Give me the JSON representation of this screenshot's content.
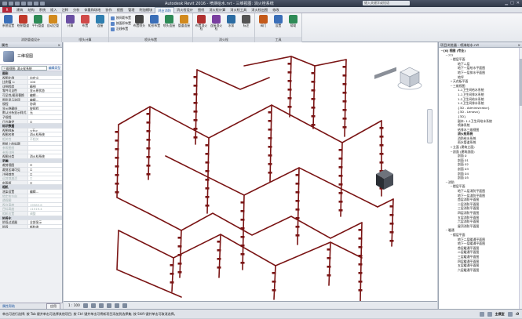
{
  "title": "Autodesk Revit 2016  -  喷淋给水.rvt  -  三维视图: 消火栓系统",
  "search_placeholder": "键入关键字或短语",
  "app_button": "R",
  "menu_tabs": [
    "建筑",
    "结构",
    "系统",
    "插入",
    "注释",
    "分析",
    "体量和场地",
    "协作",
    "视图",
    "管理",
    "附加模块",
    "鸿业消防",
    "消火栓设计",
    "图纸",
    "消火栓计算",
    "消火栓工具",
    "消火栓出图",
    "修改"
  ],
  "active_tab_index": 11,
  "ribbon": {
    "groups": [
      {
        "label": "消防管道设计",
        "buttons": [
          {
            "label": "系统设置",
            "color": "#3b6fb8"
          },
          {
            "label": "绘制管道",
            "color": "#c0392b"
          },
          {
            "label": "平行管道",
            "color": "#2e8b57"
          },
          {
            "label": "自动立管",
            "color": "#d28a1e"
          }
        ]
      },
      {
        "label": "喷头计算",
        "buttons": [
          {
            "label": "计算",
            "color": "#6a4fa3"
          },
          {
            "label": "布置",
            "color": "#d04a4a"
          },
          {
            "label": "连接",
            "color": "#2f7fb0"
          }
        ]
      },
      {
        "label": "喷头布置",
        "small": [
          "按间距布置",
          "按面积布置",
          "沿线布置"
        ],
        "buttons": [
          {
            "label": "布置喷头",
            "color": "#444"
          },
          {
            "label": "矩形布置",
            "color": "#3b6fb8"
          },
          {
            "label": "喷头连接",
            "color": "#2e8b57"
          },
          {
            "label": "管道连接",
            "color": "#d28a1e"
          }
        ]
      },
      {
        "label": "消火栓",
        "buttons": [
          {
            "label": "布置消火栓",
            "color": "#b03030"
          },
          {
            "label": "连接消火栓",
            "color": "#7a3fa0"
          },
          {
            "label": "水泵",
            "color": "#2b6ca3"
          },
          {
            "label": "标注",
            "color": "#555"
          }
        ]
      },
      {
        "label": "工具",
        "buttons": [
          {
            "label": "阀门",
            "color": "#c45a1a"
          },
          {
            "label": "设置",
            "color": "#3b6fb8"
          },
          {
            "label": "帮助",
            "color": "#2e8b57"
          }
        ]
      }
    ]
  },
  "properties": {
    "header": "属性",
    "close": "×",
    "view_type": "三维视图",
    "instance_select": "三维视图: 消火栓系统",
    "edit_type": "编辑类型",
    "rows": [
      {
        "sec": "图形"
      },
      {
        "k": "视图比例",
        "v": "自定义"
      },
      {
        "k": "比例值 1:",
        "v": "100"
      },
      {
        "k": "详细程度",
        "v": "精细"
      },
      {
        "k": "零件可见性",
        "v": "显示原状态"
      },
      {
        "k": "可见性/图形替换",
        "v": "编辑..."
      },
      {
        "k": "图形显示选项",
        "v": "编辑..."
      },
      {
        "k": "规程",
        "v": "协调"
      },
      {
        "k": "显示隐藏线",
        "v": "按规程"
      },
      {
        "k": "默认分析显示样式",
        "v": "无"
      },
      {
        "k": "子规程",
        "v": ""
      },
      {
        "k": "日光路径",
        "v": "☐"
      },
      {
        "sec": "标识数据"
      },
      {
        "k": "视图样板",
        "v": "<无>"
      },
      {
        "k": "视图名称",
        "v": "消火栓系统"
      },
      {
        "k": "相关性",
        "v": "不相关",
        "dim": true
      },
      {
        "k": "图纸上的标题",
        "v": ""
      },
      {
        "k": "参照图纸",
        "v": "",
        "dim": true
      },
      {
        "k": "参照详图",
        "v": "",
        "dim": true
      },
      {
        "k": "视图分类",
        "v": "消火栓系统"
      },
      {
        "sec": "范围"
      },
      {
        "k": "裁剪视图",
        "v": "☐"
      },
      {
        "k": "裁剪区域可见",
        "v": "☐"
      },
      {
        "k": "注释裁剪",
        "v": "☐"
      },
      {
        "k": "远剪裁激活",
        "v": "☐",
        "dim": true
      },
      {
        "k": "剖面框",
        "v": "☐"
      },
      {
        "sec": "相机"
      },
      {
        "k": "渲染设置",
        "v": "编辑..."
      },
      {
        "k": "锁定的方向",
        "v": "",
        "dim": true
      },
      {
        "k": "透视图",
        "v": "",
        "dim": true
      },
      {
        "k": "视点高度",
        "v": "19583.6",
        "dim": true
      },
      {
        "k": "目标高度",
        "v": "11519.4",
        "dim": true
      },
      {
        "k": "相机位置",
        "v": "调整",
        "dim": true
      },
      {
        "sec": "阶段化"
      },
      {
        "k": "阶段过滤器",
        "v": "全部显示"
      },
      {
        "k": "阶段",
        "v": "新构造"
      }
    ],
    "help_link": "属性帮助",
    "apply": "应用"
  },
  "view_bar": {
    "scale": "1 : 100"
  },
  "browser": {
    "header": "项目浏览器 - 喷淋给水.rvt",
    "close": "×",
    "nodes": [
      {
        "t": "[0] 视图 (专业)",
        "l": 0,
        "g": "−",
        "b": true
      },
      {
        "t": "???",
        "l": 1,
        "g": "−"
      },
      {
        "t": "楼层平面",
        "l": 2,
        "g": "−"
      },
      {
        "t": "地下二层",
        "l": 3
      },
      {
        "t": "地下一层给水平面图",
        "l": 3
      },
      {
        "t": "地下一层排水平面图",
        "l": 3
      },
      {
        "t": "地坪",
        "l": 3
      },
      {
        "t": "天花板平面",
        "l": 2,
        "g": "+"
      },
      {
        "t": "三维视图",
        "l": 2,
        "g": "−"
      },
      {
        "t": "1-1卫生间给水系统",
        "l": 3
      },
      {
        "t": "1-1卫生间排水系统",
        "l": 3
      },
      {
        "t": "1-2卫生间给水系统",
        "l": 3
      },
      {
        "t": "1-2卫生间排水系统",
        "l": 3
      },
      {
        "t": "{3D - Administrator}",
        "l": 3
      },
      {
        "t": "{3D - Lenovo}",
        "l": 3
      },
      {
        "t": "{3D}",
        "l": 3
      },
      {
        "t": "副本: 1-1卫生间给水系统",
        "l": 3
      },
      {
        "t": "喷淋系统",
        "l": 3
      },
      {
        "t": "给排水三维视图",
        "l": 3
      },
      {
        "t": "消火栓系统",
        "l": 3,
        "b": true
      },
      {
        "t": "消防给水系统",
        "l": 3
      },
      {
        "t": "雨水管道系统",
        "l": 3
      },
      {
        "t": "立面 (建筑立面)",
        "l": 2,
        "g": "+"
      },
      {
        "t": "剖面 (建筑剖面)",
        "l": 2,
        "g": "−"
      },
      {
        "t": "剖面 0",
        "l": 3
      },
      {
        "t": "剖面 01",
        "l": 3
      },
      {
        "t": "剖面 02",
        "l": 3
      },
      {
        "t": "剖面 03",
        "l": 3
      },
      {
        "t": "剖面 04",
        "l": 3
      },
      {
        "t": "剖面 05",
        "l": 3
      },
      {
        "t": "消防",
        "l": 1,
        "g": "−"
      },
      {
        "t": "楼层平面",
        "l": 2,
        "g": "−"
      },
      {
        "t": "地下二层消防平面图",
        "l": 3
      },
      {
        "t": "地下一层消防平面图",
        "l": 3
      },
      {
        "t": "首层消防平面图",
        "l": 3
      },
      {
        "t": "二层消防平面图",
        "l": 3
      },
      {
        "t": "三层消防平面图",
        "l": 3
      },
      {
        "t": "四层消防平面图",
        "l": 3
      },
      {
        "t": "五层消防平面图",
        "l": 3
      },
      {
        "t": "六层消防平面图",
        "l": 3
      },
      {
        "t": "屋顶消防平面图",
        "l": 3
      },
      {
        "t": "暖通",
        "l": 1,
        "g": "−"
      },
      {
        "t": "楼层平面",
        "l": 2,
        "g": "−"
      },
      {
        "t": "地下二层暖通平面图",
        "l": 3
      },
      {
        "t": "地下一层暖通平面图",
        "l": 3
      },
      {
        "t": "首层暖通平面图",
        "l": 3
      },
      {
        "t": "二层暖通平面图",
        "l": 3
      },
      {
        "t": "三层暖通平面图",
        "l": 3
      },
      {
        "t": "四层暖通平面图",
        "l": 3
      },
      {
        "t": "五层暖通平面图",
        "l": 3
      },
      {
        "t": "六层暖通平面图",
        "l": 3
      }
    ]
  },
  "status": {
    "text": "单击可进行选择; 按 Tab 键并单击可选择其他项目; 按 Ctrl 键并单击可将新项目添加到选择集; 按 Shift 键并单击可取消选择。",
    "model": "主模型",
    "sel": ":0"
  },
  "colors": {
    "pipe": "#7a1414",
    "accent": "#1a55a0"
  }
}
